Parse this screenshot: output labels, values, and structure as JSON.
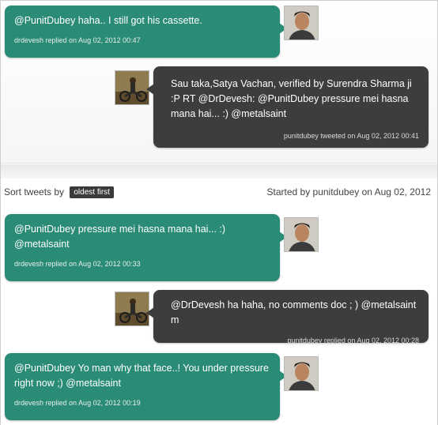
{
  "thread_top": [
    {
      "text": "@PunitDubey haha.. I still got his cassette.",
      "meta": "drdevesh replied on Aug 02, 2012 00:47",
      "avatar": "drdevesh-avatar"
    },
    {
      "text": "Sau taka,Satya Vachan, verified by Surendra Sharma ji :P RT @DrDevesh: @PunitDubey pressure mei hasna mana hai... :) @metalsaint",
      "meta": "punitdubey tweeted on Aug 02, 2012 00:41",
      "avatar": "punitdubey-avatar"
    }
  ],
  "sort": {
    "label": "Sort tweets by",
    "option": "oldest first",
    "started": "Started by punitdubey on Aug 02, 2012"
  },
  "thread_bottom": [
    {
      "text": "@PunitDubey pressure mei hasna mana hai... :) @metalsaint",
      "meta": "drdevesh replied on Aug 02, 2012 00:33",
      "avatar": "drdevesh-avatar"
    },
    {
      "text": "@DrDevesh ha haha, no comments doc ; ) @metalsaint m",
      "meta": "punitdubey replied on Aug 02, 2012 00:28",
      "avatar": "punitdubey-avatar"
    },
    {
      "text": "@PunitDubey Yo man why that face..! You under pressure right now ;) @metalsaint",
      "meta": "drdevesh replied on Aug 02, 2012 00:19",
      "avatar": "drdevesh-avatar"
    }
  ],
  "colors": {
    "teal_bubble": "#2a8b77",
    "dark_bubble": "#3d3d3d",
    "badge": "#3a3a3a"
  }
}
